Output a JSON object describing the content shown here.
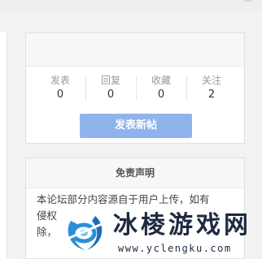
{
  "stats": {
    "items": [
      {
        "label": "发表",
        "value": "0"
      },
      {
        "label": "回复",
        "value": "0"
      },
      {
        "label": "收藏",
        "value": "0"
      },
      {
        "label": "关注",
        "value": "2"
      }
    ],
    "new_post_label": "发表新帖"
  },
  "disclaimer": {
    "title": "免责声明",
    "lines": [
      "本论坛部分内容源自于用户上传，如有",
      "侵权",
      "除，"
    ]
  },
  "watermark": {
    "title": "冰棱游戏网",
    "url": "www.yclengku.com"
  },
  "colors": {
    "accent_button": "#8fb4ec",
    "watermark_dark": "#1f2a40",
    "watermark_blue": "#2a8fd8"
  }
}
